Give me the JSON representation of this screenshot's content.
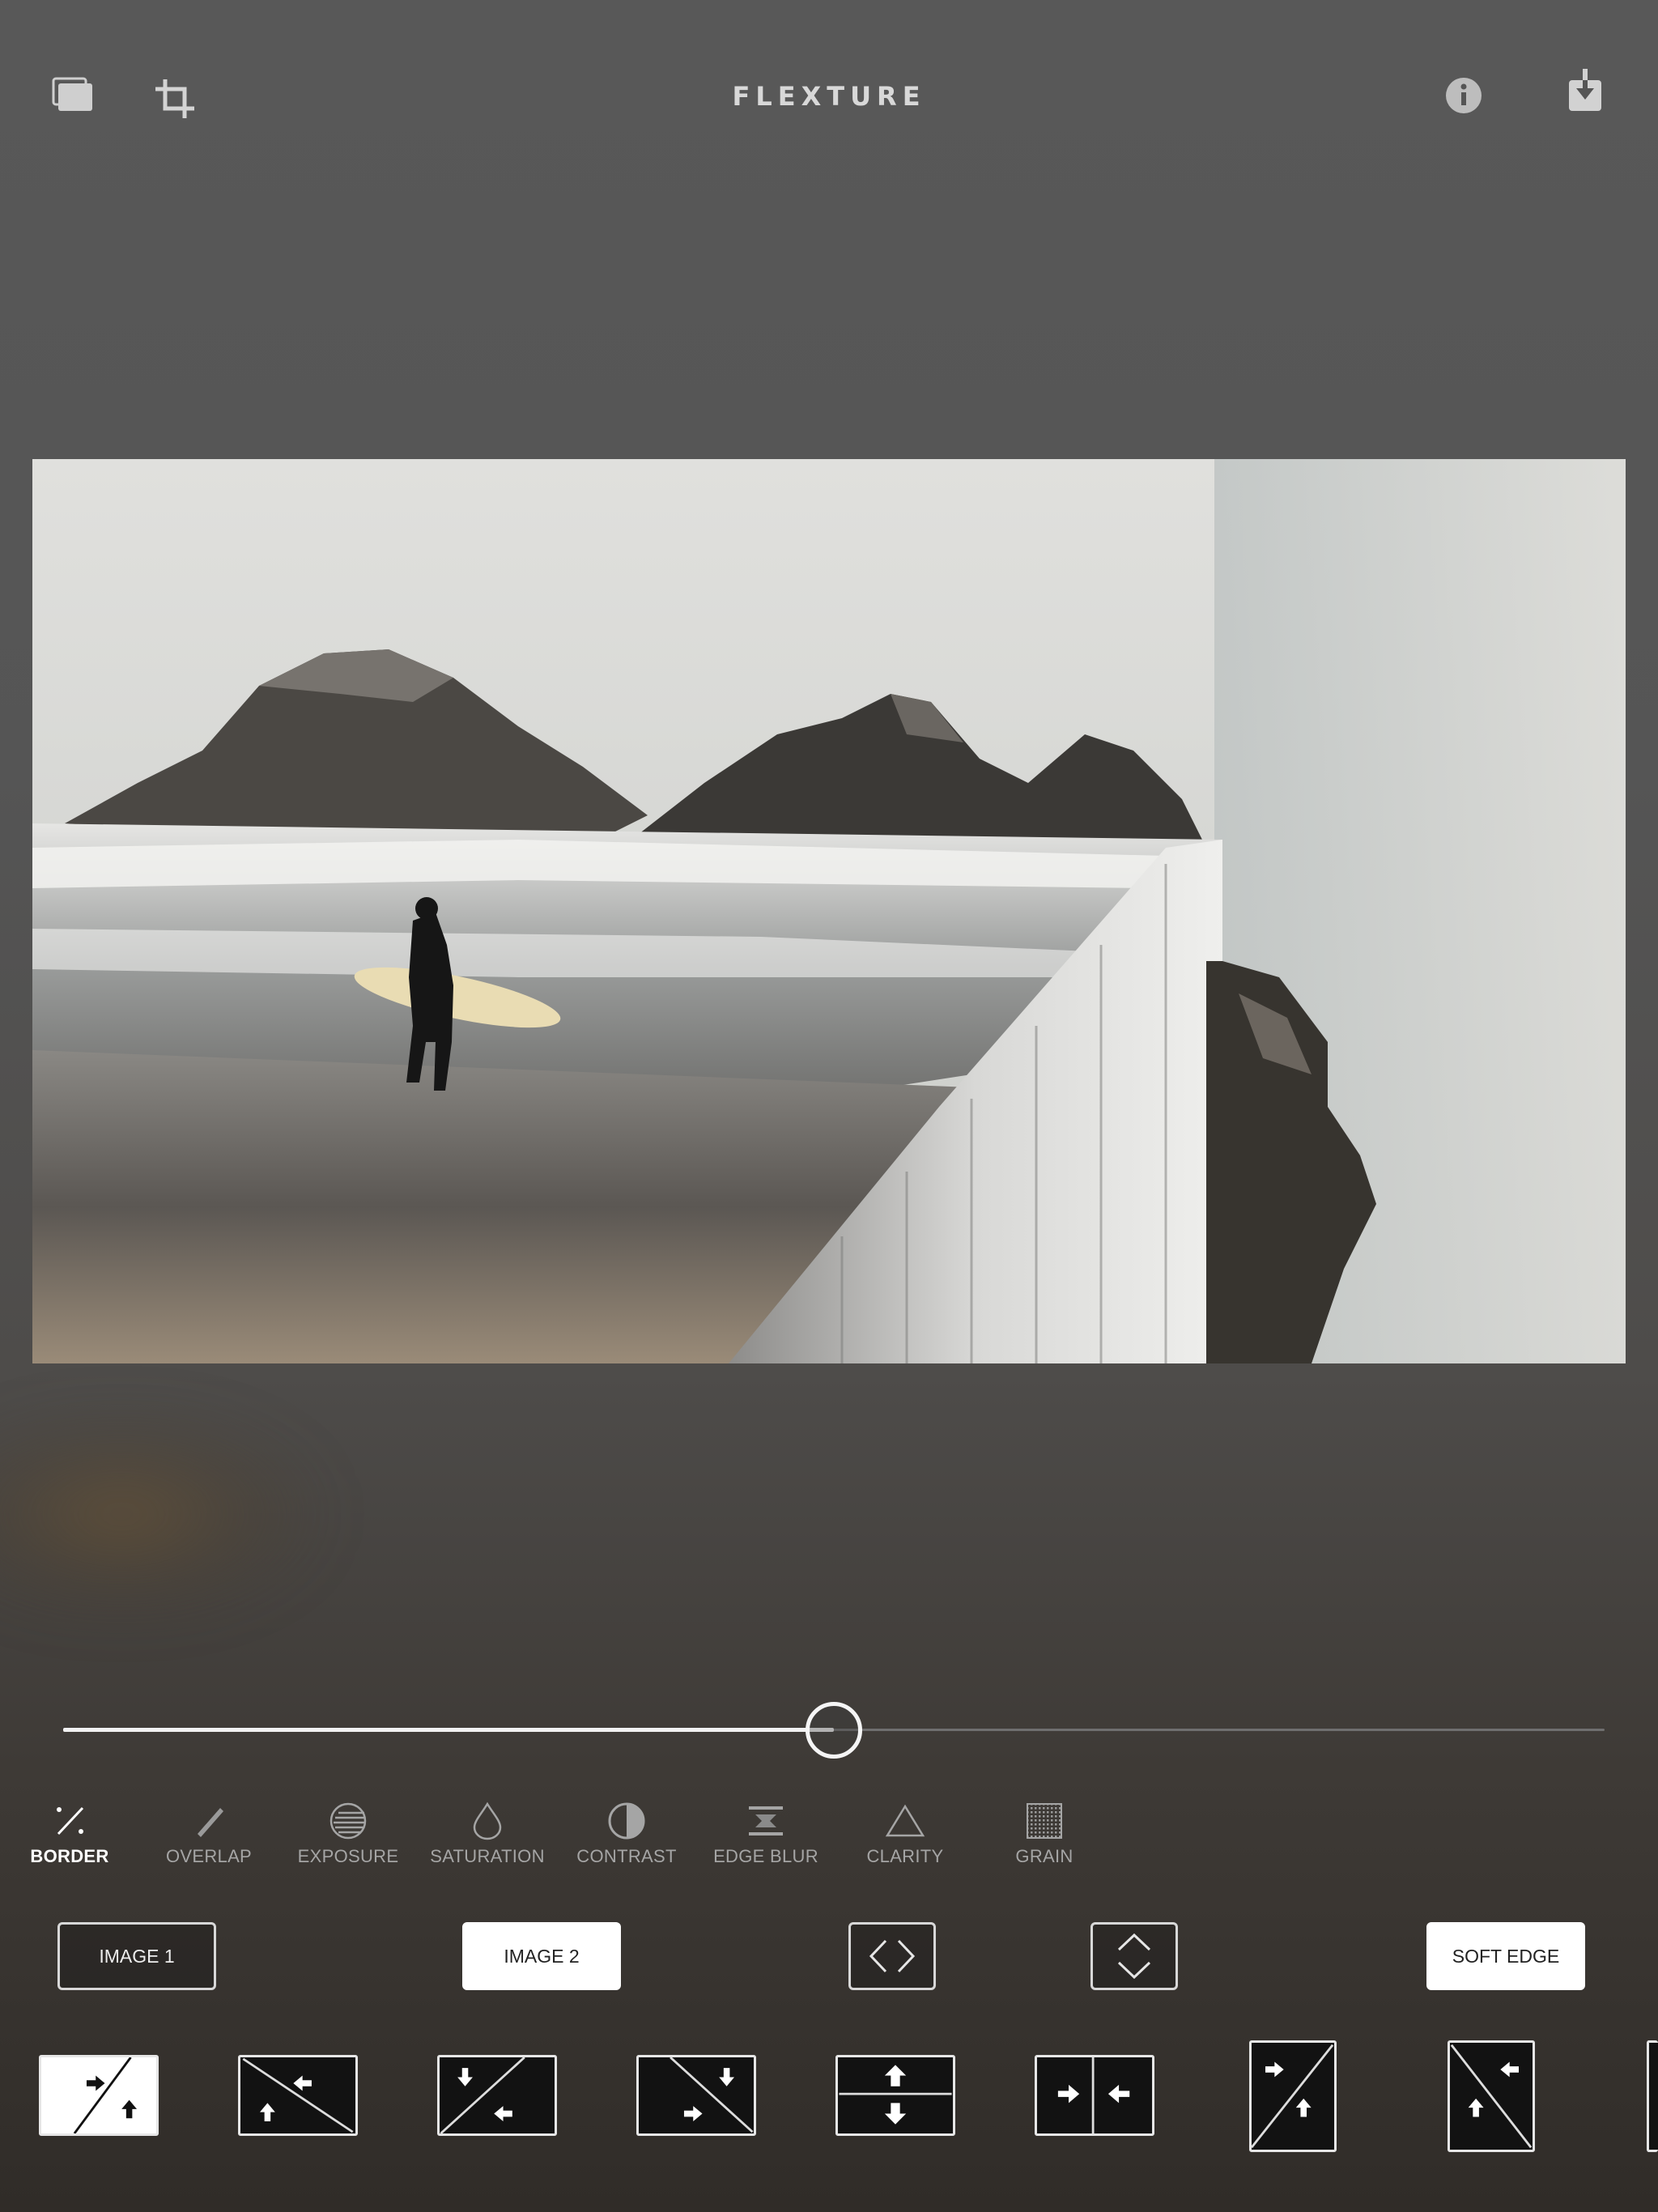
{
  "app": {
    "title": "FLEXTURE"
  },
  "toolbar": {
    "left_icons": [
      "layers-icon",
      "crop-icon"
    ],
    "right_icons": [
      "info-icon",
      "download-icon"
    ]
  },
  "slider": {
    "value_percent": 50
  },
  "tools": [
    {
      "label": "BORDER",
      "icon": "border-icon",
      "active": true
    },
    {
      "label": "OVERLAP",
      "icon": "overlap-icon",
      "active": false
    },
    {
      "label": "EXPOSURE",
      "icon": "exposure-icon",
      "active": false
    },
    {
      "label": "SATURATION",
      "icon": "saturation-icon",
      "active": false
    },
    {
      "label": "CONTRAST",
      "icon": "contrast-icon",
      "active": false
    },
    {
      "label": "EDGE BLUR",
      "icon": "edge-blur-icon",
      "active": false
    },
    {
      "label": "CLARITY",
      "icon": "clarity-icon",
      "active": false
    },
    {
      "label": "GRAIN",
      "icon": "grain-icon",
      "active": false
    }
  ],
  "options": {
    "image1": "IMAGE 1",
    "image2": "IMAGE 2",
    "soft_edge": "SOFT EDGE",
    "flip_horizontal_icon": "flip-horizontal-icon",
    "flip_vertical_icon": "flip-vertical-icon"
  },
  "transitions": [
    {
      "icon": "diagonal-right-up-icon",
      "selected": true
    },
    {
      "icon": "diagonal-left-up-icon",
      "selected": false
    },
    {
      "icon": "diagonal-down-left-icon",
      "selected": false
    },
    {
      "icon": "diagonal-right-down-icon",
      "selected": false
    },
    {
      "icon": "split-vertical-icon",
      "selected": false
    },
    {
      "icon": "split-horizontal-icon",
      "selected": false
    },
    {
      "icon": "portrait-diagonal-right-up-icon",
      "selected": false
    },
    {
      "icon": "portrait-diagonal-left-up-icon",
      "selected": false
    }
  ]
}
